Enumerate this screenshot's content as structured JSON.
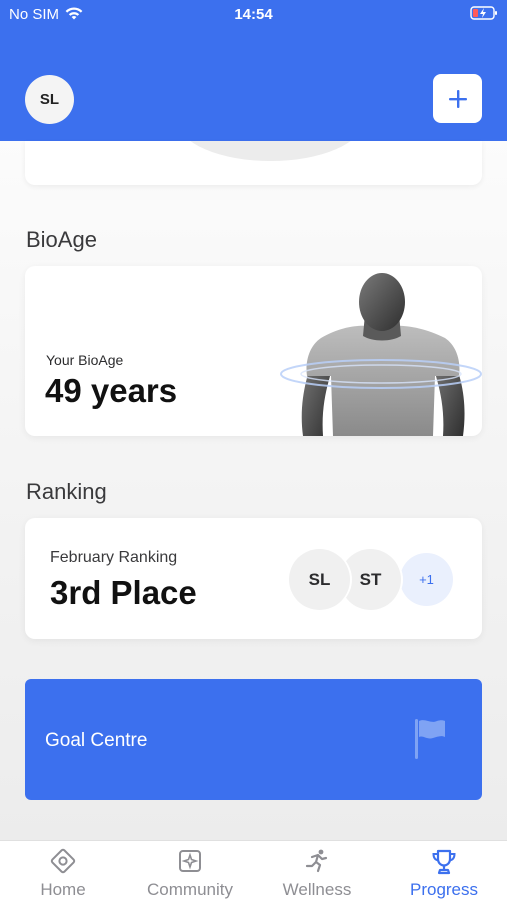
{
  "status_bar": {
    "carrier": "No SIM",
    "time": "14:54",
    "wifi_icon": "wifi-icon",
    "battery_icon": "battery-charging-icon"
  },
  "header": {
    "avatar_initials": "SL",
    "add_icon": "plus-icon"
  },
  "bioage": {
    "section_title": "BioAge",
    "label": "Your BioAge",
    "value": "49 years"
  },
  "ranking": {
    "section_title": "Ranking",
    "label": "February Ranking",
    "value": "3rd Place",
    "participants": [
      "SL",
      "ST"
    ],
    "more": "+1"
  },
  "goal": {
    "label": "Goal Centre",
    "icon": "flag-icon"
  },
  "tabs": [
    {
      "label": "Home",
      "icon": "home-icon",
      "active": false
    },
    {
      "label": "Community",
      "icon": "community-icon",
      "active": false
    },
    {
      "label": "Wellness",
      "icon": "runner-icon",
      "active": false
    },
    {
      "label": "Progress",
      "icon": "trophy-icon",
      "active": true
    }
  ],
  "colors": {
    "accent": "#3c70ee",
    "tab_inactive": "#8e8e93"
  }
}
